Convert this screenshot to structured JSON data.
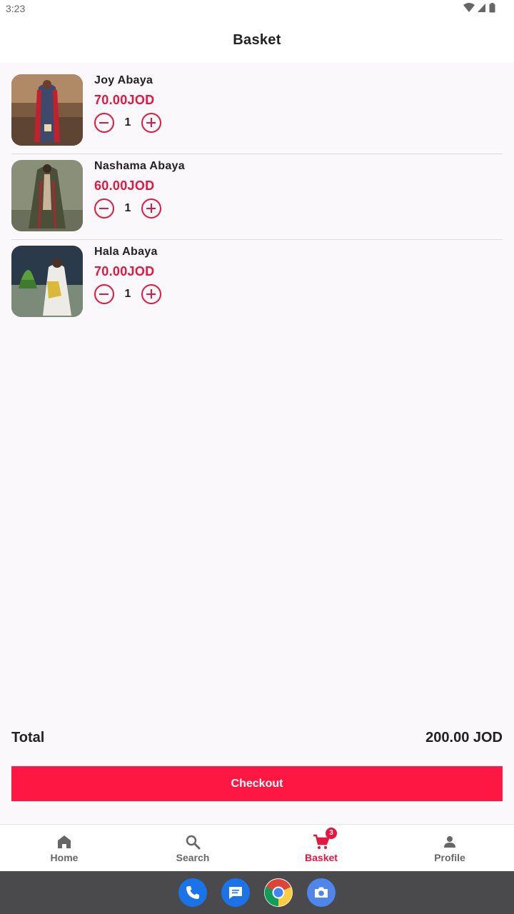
{
  "status_bar": {
    "time": "3:23",
    "icons": [
      "wifi-icon",
      "cell-signal-icon",
      "battery-icon"
    ]
  },
  "app_bar": {
    "title": "Basket"
  },
  "basket": {
    "items": [
      {
        "name": "Joy Abaya",
        "price": "70.00JOD",
        "quantity": "1",
        "image": "abaya-photo-joy"
      },
      {
        "name": "Nashama Abaya",
        "price": "60.00JOD",
        "quantity": "1",
        "image": "abaya-photo-nashama"
      },
      {
        "name": "Hala Abaya",
        "price": "70.00JOD",
        "quantity": "1",
        "image": "abaya-photo-hala"
      }
    ]
  },
  "summary": {
    "total_label": "Total",
    "total_value": "200.00 JOD"
  },
  "checkout": {
    "label": "Checkout"
  },
  "bottom_nav": {
    "items": [
      {
        "label": "Home",
        "icon": "home-icon",
        "active": false
      },
      {
        "label": "Search",
        "icon": "search-icon",
        "active": false
      },
      {
        "label": "Basket",
        "icon": "cart-icon",
        "active": true,
        "badge": "3"
      },
      {
        "label": "Profile",
        "icon": "person-icon",
        "active": false
      }
    ]
  },
  "dock": {
    "apps": [
      "phone-icon",
      "messages-icon",
      "chrome-icon",
      "camera-icon"
    ]
  },
  "colors": {
    "accent": "#ff1744",
    "price": "#e5173f",
    "background": "#faf8fa",
    "dock": "#4a4a4c"
  }
}
